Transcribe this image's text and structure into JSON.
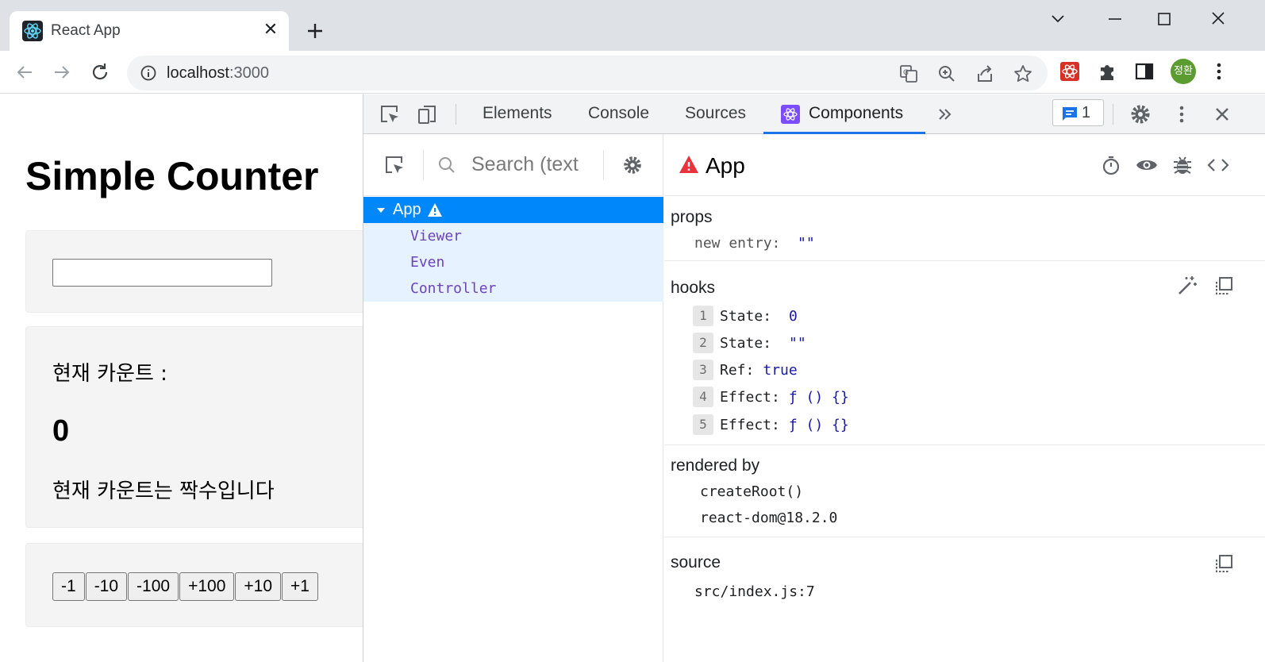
{
  "browser": {
    "tab_title": "React App",
    "url_host": "localhost",
    "url_port": ":3000",
    "profile_initials": "정환",
    "accent": "#1a73e8"
  },
  "page": {
    "title": "Simple Counter",
    "input_value": "",
    "count_label": "현재 카운트 :",
    "count_value": "0",
    "even_text": "현재 카운트는 짝수입니다",
    "buttons": [
      "-1",
      "-10",
      "-100",
      "+100",
      "+10",
      "+1"
    ]
  },
  "devtools": {
    "tabs": [
      "Elements",
      "Console",
      "Sources",
      "Components"
    ],
    "active_tab": "Components",
    "issues_count": "1",
    "search_placeholder": "Search (text",
    "tree": {
      "selected": "App",
      "children": [
        "Viewer",
        "Even",
        "Controller"
      ]
    },
    "inspector": {
      "component": "App",
      "props_title": "props",
      "props_entry_key": "new entry",
      "props_entry_value": "\"\"",
      "hooks_title": "hooks",
      "hooks": [
        {
          "index": "1",
          "name": "State",
          "value": "0"
        },
        {
          "index": "2",
          "name": "State",
          "value": "\"\""
        },
        {
          "index": "3",
          "name": "Ref",
          "value": "true"
        },
        {
          "index": "4",
          "name": "Effect",
          "value": "ƒ () {}"
        },
        {
          "index": "5",
          "name": "Effect",
          "value": "ƒ () {}"
        }
      ],
      "rendered_by_title": "rendered by",
      "rendered_by": [
        "createRoot()",
        "react-dom@18.2.0"
      ],
      "source_title": "source",
      "source": "src/index.js:7"
    }
  }
}
